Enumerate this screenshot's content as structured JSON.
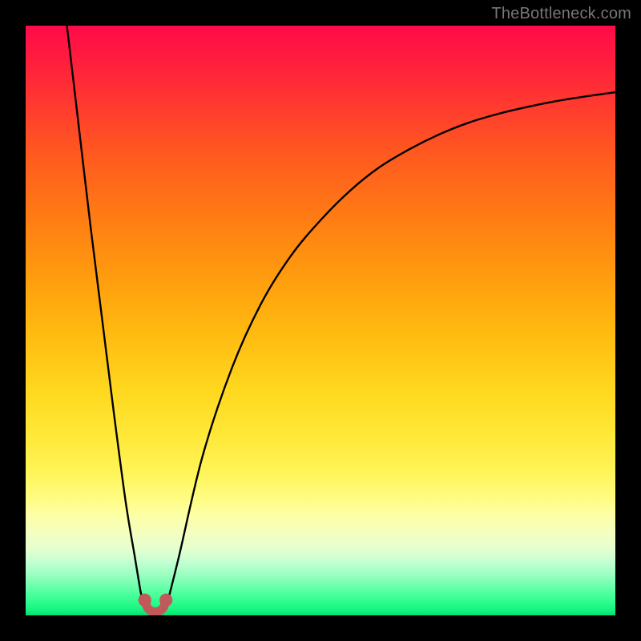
{
  "watermark": "TheBottleneck.com",
  "chart_data": {
    "type": "line",
    "title": "",
    "xlabel": "",
    "ylabel": "",
    "xlim": [
      0,
      100
    ],
    "ylim": [
      0,
      100
    ],
    "grid": false,
    "legend": false,
    "background": "vertical-gradient red→orange→yellow→green",
    "series": [
      {
        "name": "left-branch",
        "x": [
          7,
          9,
          11,
          13,
          15,
          17,
          18.5,
          19.5,
          20
        ],
        "y": [
          100,
          83,
          66,
          50,
          34,
          19,
          10,
          4,
          2
        ]
      },
      {
        "name": "valley-bottom",
        "x": [
          19.5,
          20,
          20.5,
          21,
          21.5,
          22,
          22.5,
          23,
          23.5,
          24,
          24.5
        ],
        "y": [
          4,
          2,
          1,
          0.5,
          0.3,
          0.3,
          0.3,
          0.5,
          1,
          2,
          4
        ]
      },
      {
        "name": "right-branch",
        "x": [
          24,
          26,
          30,
          35,
          40,
          45,
          50,
          55,
          60,
          65,
          70,
          75,
          80,
          85,
          90,
          95,
          100
        ],
        "y": [
          2,
          10,
          27,
          42,
          53,
          61,
          67,
          72,
          76,
          79,
          81.5,
          83.5,
          85,
          86.2,
          87.2,
          88,
          88.7
        ]
      }
    ],
    "markers": [
      {
        "name": "valley-arc-left",
        "cx": 20.2,
        "cy": 2.6,
        "r": 1.1,
        "color": "#c1595b"
      },
      {
        "name": "valley-arc-right",
        "cx": 23.8,
        "cy": 2.6,
        "r": 1.1,
        "color": "#c1595b"
      }
    ],
    "valley_u": {
      "color": "#c1595b",
      "stroke_width": 1.5,
      "x": [
        20.2,
        20.6,
        21.2,
        22,
        22.8,
        23.4,
        23.8
      ],
      "y": [
        2.6,
        1.4,
        0.8,
        0.6,
        0.8,
        1.4,
        2.6
      ]
    }
  }
}
